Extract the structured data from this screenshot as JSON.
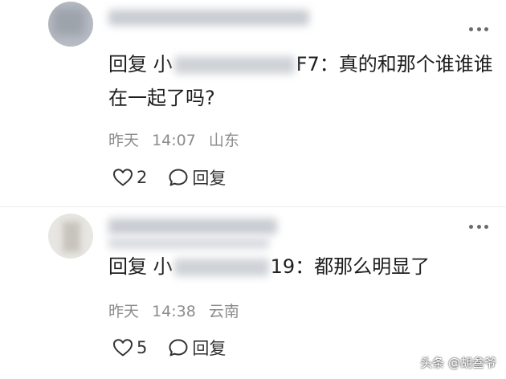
{
  "comments": [
    {
      "reply_prefix": "回复",
      "mention_start": "小",
      "mention_end": "F7",
      "separator": "：",
      "reply_body": "真的和那个谁谁谁在一起了吗?",
      "date": "昨天",
      "time": "14:07",
      "location": "山东",
      "like_count": "2",
      "reply_label": "回复"
    },
    {
      "reply_prefix": "回复",
      "mention_start": "小",
      "mention_end": "19",
      "separator": "：",
      "reply_body": "都那么明显了",
      "date": "昨天",
      "time": "14:38",
      "location": "云南",
      "like_count": "5",
      "reply_label": "回复"
    }
  ],
  "watermark": "头条 @胡叁爷",
  "icons": {
    "like": "heart-outline-icon",
    "reply": "speech-bubble-icon",
    "more": "more-dots-icon"
  }
}
